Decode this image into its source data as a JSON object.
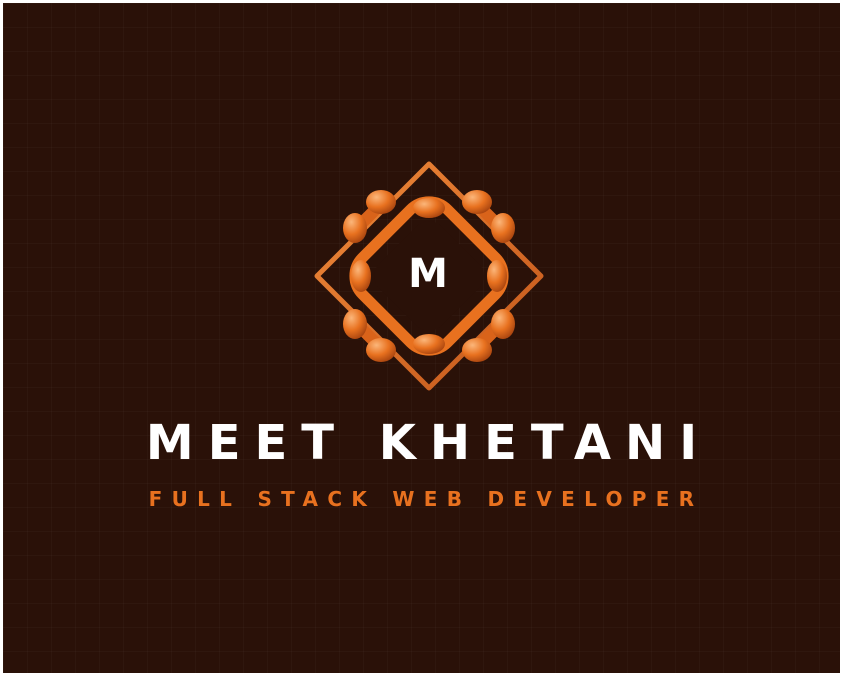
{
  "logo": {
    "letter": "M",
    "icon": "diamond-molecule-emblem",
    "colors": {
      "primary": "#e8711f",
      "light": "#f7a25c",
      "dark": "#a8440f"
    }
  },
  "name": "MEET KHETANI",
  "tagline": "FULL STACK WEB DEVELOPER",
  "colors": {
    "background": "#2a1108",
    "name_text": "#ffffff",
    "tagline_text": "#e8711f"
  }
}
